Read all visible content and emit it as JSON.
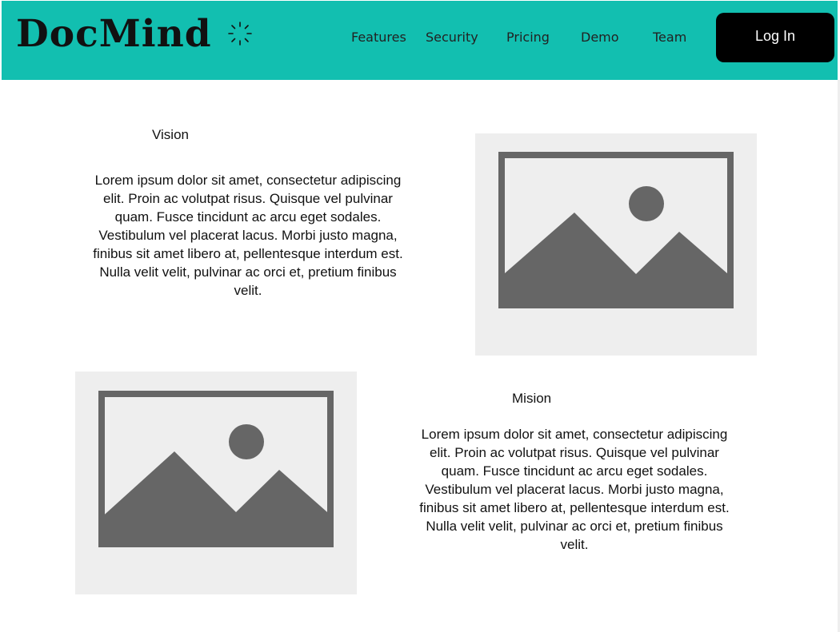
{
  "header": {
    "brand": "DocMind",
    "brand_icon": "sparkle-icon",
    "nav": [
      {
        "label": "Features"
      },
      {
        "label": "Security"
      },
      {
        "label": "Pricing"
      },
      {
        "label": "Demo"
      },
      {
        "label": "Team"
      }
    ],
    "login_label": "Log In"
  },
  "sections": {
    "vision": {
      "title": "Vision",
      "text": "Lorem ipsum dolor sit amet, consectetur adipiscing elit. Proin ac volutpat risus. Quisque vel pulvinar quam. Fusce tincidunt ac arcu eget sodales. Vestibulum vel placerat lacus. Morbi justo magna, finibus sit amet libero at, pellentesque interdum est. Nulla velit velit, pulvinar ac orci et, pretium finibus velit.",
      "image_icon": "image-placeholder-icon"
    },
    "mission": {
      "title": "Mision",
      "text": "Lorem ipsum dolor sit amet, consectetur adipiscing elit. Proin ac volutpat risus. Quisque vel pulvinar quam. Fusce tincidunt ac arcu eget sodales. Vestibulum vel placerat lacus. Morbi justo magna, finibus sit amet libero at, pellentesque interdum est. Nulla velit velit, pulvinar ac orci et, pretium finibus velit.",
      "image_icon": "image-placeholder-icon"
    }
  },
  "colors": {
    "header_bg": "#12bfb0",
    "button_bg": "#000000",
    "placeholder_bg": "#eeeeee",
    "placeholder_fg": "#666666"
  }
}
